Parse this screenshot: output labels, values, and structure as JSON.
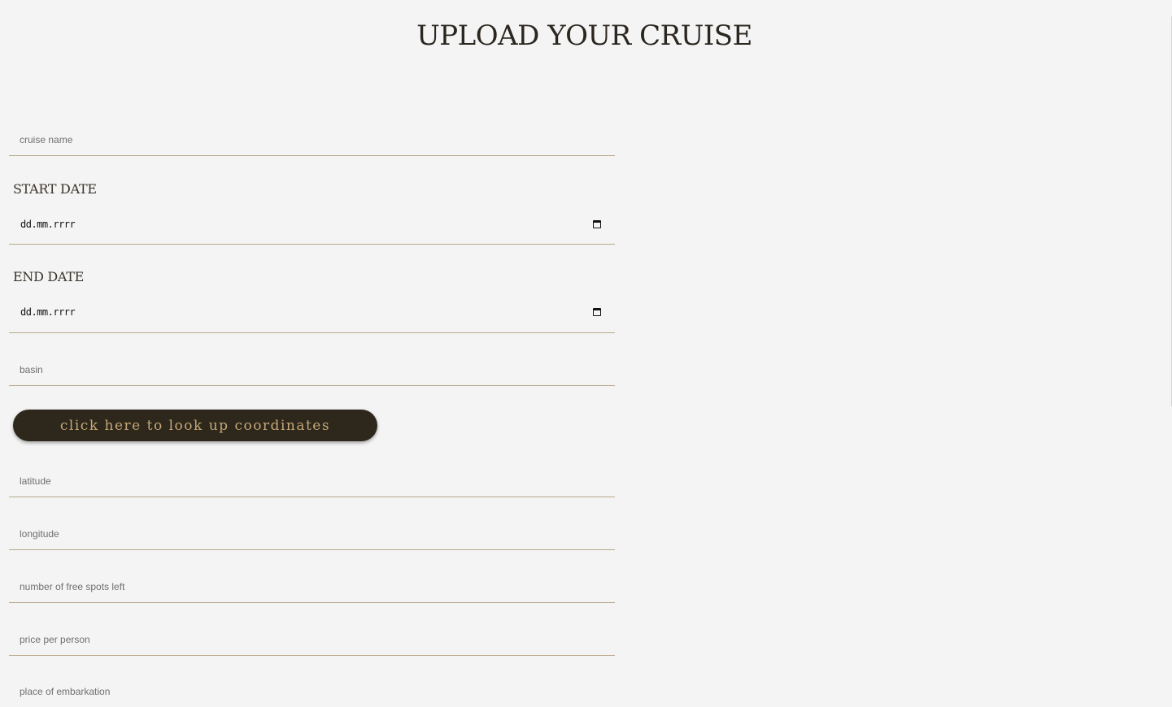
{
  "page": {
    "title": "UPLOAD YOUR CRUISE"
  },
  "form": {
    "cruise_name": {
      "placeholder": "cruise name",
      "value": ""
    },
    "start_date": {
      "label": "START DATE",
      "display": "dd.mm.rrrr"
    },
    "end_date": {
      "label": "END DATE",
      "display": "dd.mm.rrrr"
    },
    "basin": {
      "placeholder": "basin",
      "value": ""
    },
    "lookup_button": {
      "label": "click here to look up coordinates"
    },
    "latitude": {
      "placeholder": "latitude",
      "value": ""
    },
    "longitude": {
      "placeholder": "longitude",
      "value": ""
    },
    "free_spots": {
      "placeholder": "number of free spots left",
      "value": ""
    },
    "price": {
      "placeholder": "price per person",
      "value": ""
    },
    "embarkation": {
      "placeholder": "place of embarkation",
      "value": ""
    }
  },
  "icons": {
    "calendar": "calendar-icon"
  },
  "colors": {
    "background": "#f4f4f4",
    "underline": "#b8a88c",
    "button_bg": "#2e271b",
    "button_text": "#c4a878",
    "title": "#2b2720"
  }
}
